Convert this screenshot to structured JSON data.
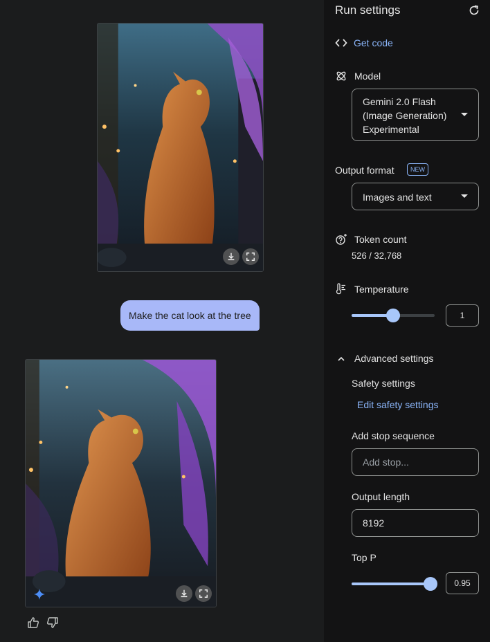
{
  "chat": {
    "messages": [
      {
        "role": "model",
        "type": "image",
        "alt": "generated-cat-image-1"
      },
      {
        "role": "user",
        "text": "Make the cat look at the tree"
      },
      {
        "role": "model",
        "type": "image",
        "alt": "generated-cat-image-2"
      }
    ],
    "image_actions": [
      "download-icon",
      "fullscreen-icon"
    ],
    "feedback_icons": [
      "thumb-up-icon",
      "thumb-down-icon"
    ]
  },
  "settings": {
    "title": "Run settings",
    "get_code": "Get code",
    "model": {
      "label": "Model",
      "value_lines": [
        "Gemini 2.0 Flash",
        "(Image Generation)",
        "Experimental"
      ]
    },
    "output_format": {
      "label": "Output format",
      "badge": "NEW",
      "value": "Images and text"
    },
    "token_count": {
      "label": "Token count",
      "value": "526 / 32,768"
    },
    "temperature": {
      "label": "Temperature",
      "value": "1",
      "fraction": 0.5
    },
    "advanced": {
      "label": "Advanced settings",
      "safety_label": "Safety settings",
      "edit_safety": "Edit safety settings",
      "stop_label": "Add stop sequence",
      "stop_placeholder": "Add stop...",
      "output_length_label": "Output length",
      "output_length_value": "8192",
      "top_p_label": "Top P",
      "top_p_value": "0.95",
      "top_p_fraction": 0.95
    }
  },
  "colors": {
    "accent": "#8ab4f8",
    "slider": "#a8c7fa",
    "user_bubble": "#a8b8f8",
    "panel_bg": "#131314",
    "chat_bg": "#1b1c1d"
  }
}
